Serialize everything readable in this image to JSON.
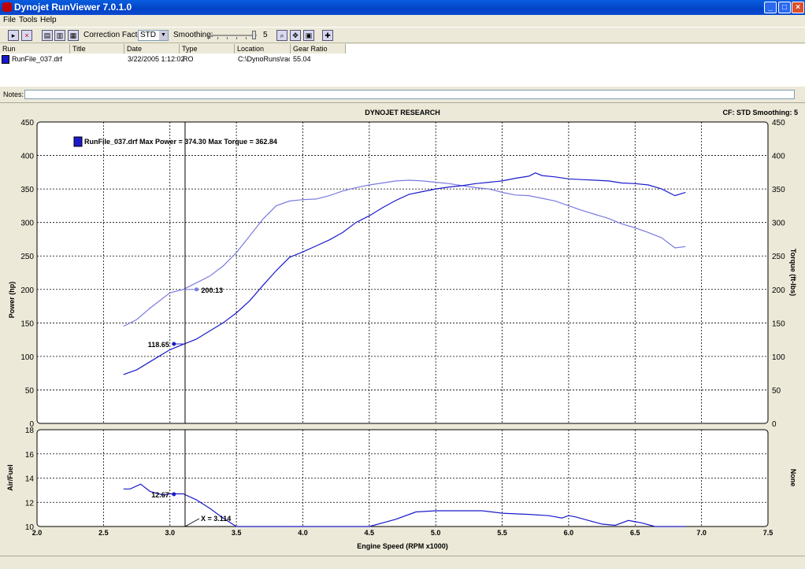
{
  "window": {
    "title": "Dynojet RunViewer 7.0.1.0"
  },
  "menu": [
    "File",
    "Tools",
    "Help"
  ],
  "toolbar": {
    "cf_label": "Correction Factor:",
    "cf_value": "STD",
    "smoothing_label": "Smoothing:",
    "smoothing_value": "5"
  },
  "runlist": {
    "columns": [
      "Run",
      "Title",
      "Date",
      "Type",
      "Location",
      "Gear Ratio"
    ],
    "rows": [
      {
        "run": "RunFile_037.drf",
        "title": "",
        "date": "3/22/2005 1:12:02",
        "type": "RO",
        "location": "C:\\DynoRuns\\race",
        "gear_ratio": "55.04"
      }
    ]
  },
  "notes": {
    "label": "Notes:",
    "value": ""
  },
  "graph": {
    "header": "DYNOJET RESEARCH",
    "cf_smoothing": "CF: STD  Smoothing: 5",
    "legend": "RunFile_037.drf Max Power = 374.30 Max Torque = 362.84",
    "cursor_label": "X = 3.114",
    "marker_torque": "200.13",
    "marker_power": "118.65",
    "marker_af": "12.67"
  },
  "colors": {
    "power": "#1a1acc",
    "torque": "#7a7ae0",
    "airfuel": "#1a1acc",
    "plot_bg": "#ffffff",
    "window_bg": "#ece9d8",
    "titlebar": "#0a5ee0"
  },
  "chart_data": [
    {
      "type": "line",
      "title": "DYNOJET RESEARCH",
      "xlabel": "Engine Speed (RPM x1000)",
      "ylabel": "Power (hp)",
      "y2label": "Torque (ft-lbs)",
      "xlim": [
        2.0,
        7.5
      ],
      "ylim": [
        0,
        450
      ],
      "y2lim": [
        0,
        450
      ],
      "x_ticks": [
        "2.0",
        "2.5",
        "3.0",
        "3.5",
        "4.0",
        "4.5",
        "5.0",
        "5.5",
        "6.0",
        "6.5",
        "7.0",
        "7.5"
      ],
      "y_ticks": [
        "0",
        "50",
        "100",
        "150",
        "200",
        "250",
        "300",
        "350",
        "400",
        "450"
      ],
      "grid": true,
      "legend": "top-left",
      "series": [
        {
          "name": "Power",
          "axis": "left",
          "x": [
            2.65,
            2.75,
            2.85,
            3.0,
            3.1,
            3.2,
            3.3,
            3.4,
            3.5,
            3.6,
            3.7,
            3.8,
            3.9,
            4.0,
            4.1,
            4.2,
            4.3,
            4.4,
            4.5,
            4.6,
            4.7,
            4.8,
            4.9,
            5.0,
            5.1,
            5.2,
            5.3,
            5.4,
            5.5,
            5.6,
            5.7,
            5.75,
            5.8,
            5.9,
            6.0,
            6.1,
            6.2,
            6.3,
            6.4,
            6.5,
            6.6,
            6.7,
            6.8,
            6.88
          ],
          "y": [
            73,
            80,
            92,
            110,
            118,
            126,
            138,
            150,
            165,
            183,
            206,
            228,
            248,
            256,
            265,
            274,
            285,
            300,
            310,
            322,
            333,
            342,
            346,
            350,
            353,
            355,
            358,
            360,
            362,
            366,
            369,
            374,
            370,
            368,
            365,
            364,
            363,
            362,
            359,
            358,
            356,
            350,
            340,
            345
          ]
        },
        {
          "name": "Torque",
          "axis": "right",
          "x": [
            2.65,
            2.75,
            2.85,
            3.0,
            3.1,
            3.2,
            3.3,
            3.4,
            3.5,
            3.6,
            3.7,
            3.8,
            3.9,
            4.0,
            4.1,
            4.2,
            4.3,
            4.4,
            4.5,
            4.6,
            4.7,
            4.8,
            4.9,
            5.0,
            5.1,
            5.2,
            5.3,
            5.4,
            5.5,
            5.6,
            5.7,
            5.8,
            5.9,
            6.0,
            6.1,
            6.2,
            6.3,
            6.4,
            6.5,
            6.6,
            6.7,
            6.8,
            6.88
          ],
          "y": [
            145,
            155,
            172,
            195,
            200,
            210,
            220,
            235,
            255,
            280,
            305,
            325,
            332,
            334,
            335,
            340,
            347,
            352,
            356,
            359,
            362,
            363,
            362,
            360,
            358,
            355,
            352,
            350,
            345,
            341,
            340,
            336,
            332,
            325,
            318,
            312,
            306,
            298,
            292,
            285,
            277,
            262,
            264
          ]
        }
      ]
    },
    {
      "type": "line",
      "xlabel": "Engine Speed (RPM x1000)",
      "ylabel": "Air/Fuel",
      "y2label": "None",
      "xlim": [
        2.0,
        7.5
      ],
      "ylim": [
        10,
        18
      ],
      "x_ticks": [
        "2.0",
        "2.5",
        "3.0",
        "3.5",
        "4.0",
        "4.5",
        "5.0",
        "5.5",
        "6.0",
        "6.5",
        "7.0",
        "7.5"
      ],
      "y_ticks": [
        "10",
        "12",
        "14",
        "16",
        "18"
      ],
      "grid": true,
      "series": [
        {
          "name": "Air/Fuel",
          "x": [
            2.65,
            2.7,
            2.78,
            2.85,
            2.95,
            3.0,
            3.1,
            3.2,
            3.3,
            3.4,
            3.5,
            3.6,
            3.8,
            4.0,
            4.5,
            4.7,
            4.85,
            5.0,
            5.2,
            5.35,
            5.5,
            5.7,
            5.85,
            5.95,
            6.0,
            6.05,
            6.15,
            6.25,
            6.35,
            6.45,
            6.5,
            6.55,
            6.65,
            6.88
          ],
          "y": [
            13.1,
            13.1,
            13.5,
            12.9,
            12.6,
            12.7,
            12.7,
            12.2,
            11.5,
            10.7,
            10.0,
            10.0,
            10.0,
            10.0,
            10.0,
            10.6,
            11.2,
            11.3,
            11.3,
            11.3,
            11.1,
            11.0,
            10.9,
            10.7,
            10.9,
            10.8,
            10.5,
            10.2,
            10.1,
            10.5,
            10.4,
            10.3,
            10.0,
            10.0
          ]
        }
      ]
    }
  ]
}
